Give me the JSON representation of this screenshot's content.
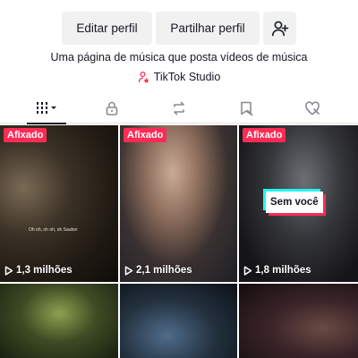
{
  "profile": {
    "edit_label": "Editar perfil",
    "share_label": "Partilhar perfil",
    "bio": "Uma página de música que posta vídeos de música",
    "studio_label": "TikTok Studio"
  },
  "tabs": [
    {
      "name": "videos",
      "icon": "grid-icon",
      "active": true
    },
    {
      "name": "private",
      "icon": "lock-icon",
      "active": false
    },
    {
      "name": "reposts",
      "icon": "repost-icon",
      "active": false
    },
    {
      "name": "favorites",
      "icon": "bookmark-icon",
      "active": false
    },
    {
      "name": "liked",
      "icon": "heart-icon",
      "active": false
    }
  ],
  "videos": [
    {
      "pinned_label": "Afixado",
      "views": "1,3 milhões",
      "caption": "Oh oh, oh oh, oh Sauber"
    },
    {
      "pinned_label": "Afixado",
      "views": "2,1 milhões"
    },
    {
      "pinned_label": "Afixado",
      "views": "1,8 milhões",
      "overlay": "Sem você"
    },
    {},
    {},
    {}
  ],
  "colors": {
    "accent": "#fe2c55",
    "cyan": "#25f4ee",
    "button_bg": "#f1f1f2"
  }
}
